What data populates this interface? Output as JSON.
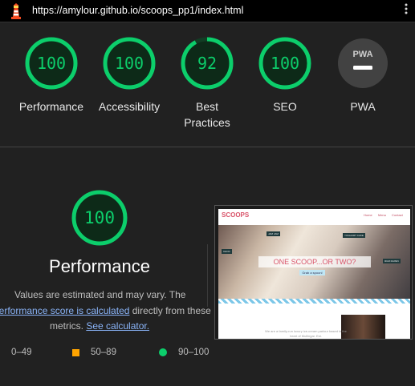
{
  "browser": {
    "url": "https://amylour.github.io/scoops_pp1/index.html"
  },
  "colors": {
    "pass": "#0cce6b",
    "average": "#ffa400",
    "fail": "#ff4e42",
    "link": "#8ab4f8"
  },
  "categories": [
    {
      "label": "Performance",
      "score": "100",
      "fraction": 1.0
    },
    {
      "label": "Accessibility",
      "score": "100",
      "fraction": 1.0
    },
    {
      "label": "Best\nPractices",
      "score": "92",
      "fraction": 0.92
    },
    {
      "label": "SEO",
      "score": "100",
      "fraction": 1.0
    },
    {
      "label": "PWA",
      "badge": "PWA",
      "icon": "pwa-badge-icon"
    }
  ],
  "performance_section": {
    "score": "100",
    "fraction": 1.0,
    "title": "Performance",
    "desc_line1": "Values are estimated and may vary. The",
    "desc_link1": "performance score is calculated",
    "desc_text2": " directly from these",
    "desc_text3": "metrics. ",
    "desc_link2": "See calculator.",
    "legend": [
      {
        "range": "0–49",
        "icon": "triangle-fail-icon"
      },
      {
        "range": "50–89",
        "icon": "square-average-icon"
      },
      {
        "range": "90–100",
        "icon": "circle-pass-icon"
      }
    ]
  },
  "screenshot": {
    "brand": "SCOOPS",
    "nav": [
      "Home",
      "Menu",
      "Contact"
    ],
    "hero_title": "ONE SCOOP...OR TWO?",
    "hero_button": "Grab a spoon!",
    "signs": [
      "JAM JAM",
      "YOGHURT CAKE",
      "RUM RAISIN",
      "CHOC"
    ],
    "intro_text": "We are a family-run luxury ice-cream parlour based in the heart of Mullingar. Est."
  }
}
